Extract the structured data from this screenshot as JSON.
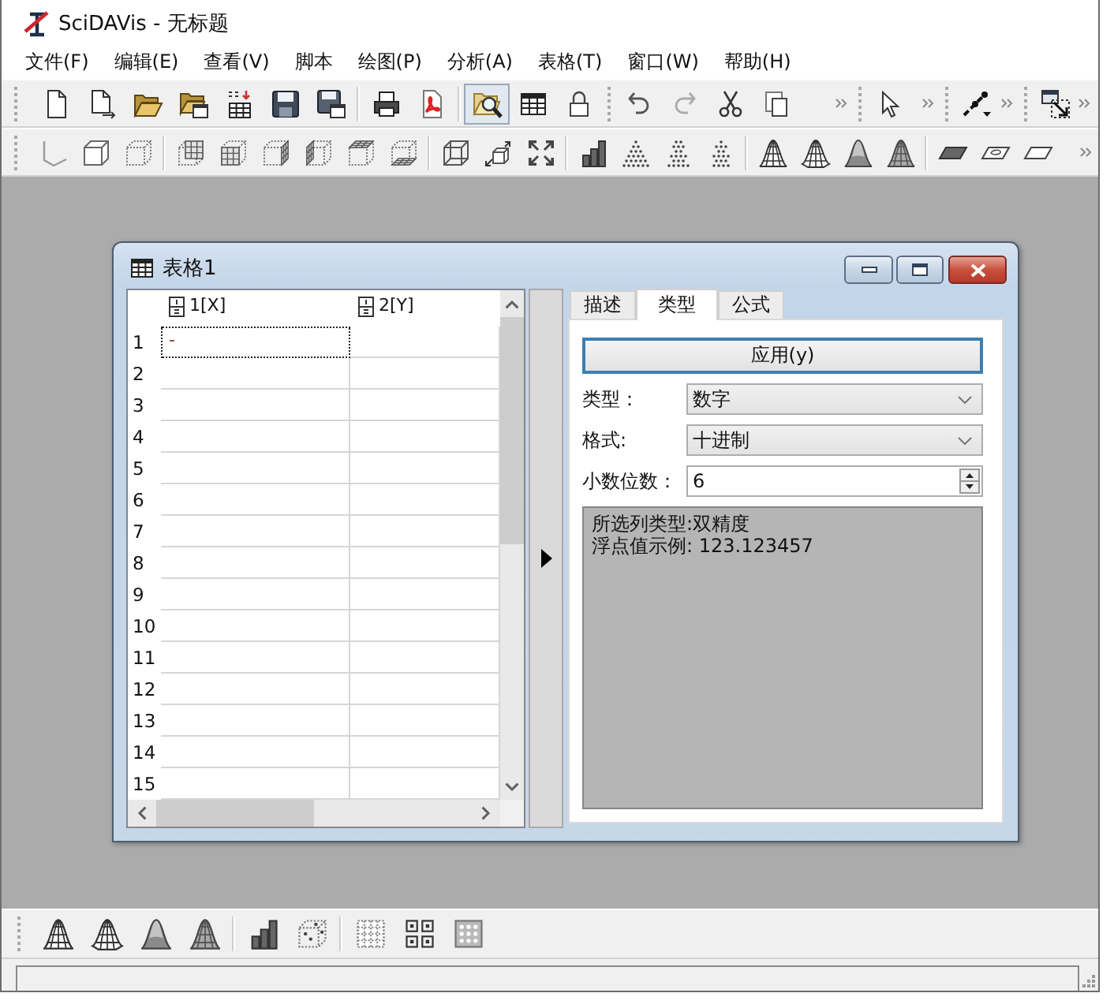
{
  "window": {
    "title": "SciDAVis - 无标题"
  },
  "menu": [
    "文件(F)",
    "编辑(E)",
    "查看(V)",
    "脚本",
    "绘图(P)",
    "分析(A)",
    "表格(T)",
    "窗口(W)",
    "帮助(H)"
  ],
  "file_toolbar": {
    "folder_search_button": {
      "checked": true
    }
  },
  "table_window": {
    "title": "表格1",
    "table": {
      "columns": [
        "1[X]",
        "2[Y]"
      ],
      "rows": [
        {
          "number": "1",
          "cells": [
            {
              "text": "-",
              "focused": true
            },
            {
              "focused": false
            }
          ]
        },
        {
          "number": "2",
          "cells": [
            {
              "focused": false
            },
            {
              "focused": false
            }
          ]
        },
        {
          "number": "3",
          "cells": [
            {
              "focused": false
            },
            {
              "focused": false
            }
          ]
        },
        {
          "number": "4",
          "cells": [
            {
              "focused": false
            },
            {
              "focused": false
            }
          ]
        },
        {
          "number": "5",
          "cells": [
            {
              "focused": false
            },
            {
              "focused": false
            }
          ]
        },
        {
          "number": "6",
          "cells": [
            {
              "focused": false
            },
            {
              "focused": false
            }
          ]
        },
        {
          "number": "7",
          "cells": [
            {
              "focused": false
            },
            {
              "focused": false
            }
          ]
        },
        {
          "number": "8",
          "cells": [
            {
              "focused": false
            },
            {
              "focused": false
            }
          ]
        },
        {
          "number": "9",
          "cells": [
            {
              "focused": false
            },
            {
              "focused": false
            }
          ]
        },
        {
          "number": "10",
          "cells": [
            {
              "focused": false
            },
            {
              "focused": false
            }
          ]
        },
        {
          "number": "11",
          "cells": [
            {
              "focused": false
            },
            {
              "focused": false
            }
          ]
        },
        {
          "number": "12",
          "cells": [
            {
              "focused": false
            },
            {
              "focused": false
            }
          ]
        },
        {
          "number": "13",
          "cells": [
            {
              "focused": false
            },
            {
              "focused": false
            }
          ]
        },
        {
          "number": "14",
          "cells": [
            {
              "focused": false
            },
            {
              "focused": false
            }
          ]
        },
        {
          "number": "15",
          "cells": [
            {
              "focused": false
            },
            {
              "focused": false
            }
          ]
        }
      ]
    },
    "tabs": [
      {
        "label": "描述",
        "selected": false
      },
      {
        "label": "类型",
        "selected": true
      },
      {
        "label": "公式",
        "selected": false
      }
    ],
    "type_tab": {
      "apply_button": "应用(y)",
      "fields": [
        {
          "kind": "combo",
          "label": "类型：",
          "value": "数字"
        },
        {
          "kind": "combo",
          "label": "格式:",
          "value": "十进制"
        },
        {
          "kind": "spin",
          "label": "小数位数：",
          "value": "6"
        }
      ],
      "info": [
        "所选列类型:双精度",
        "浮点值示例: 123.123457"
      ]
    }
  }
}
